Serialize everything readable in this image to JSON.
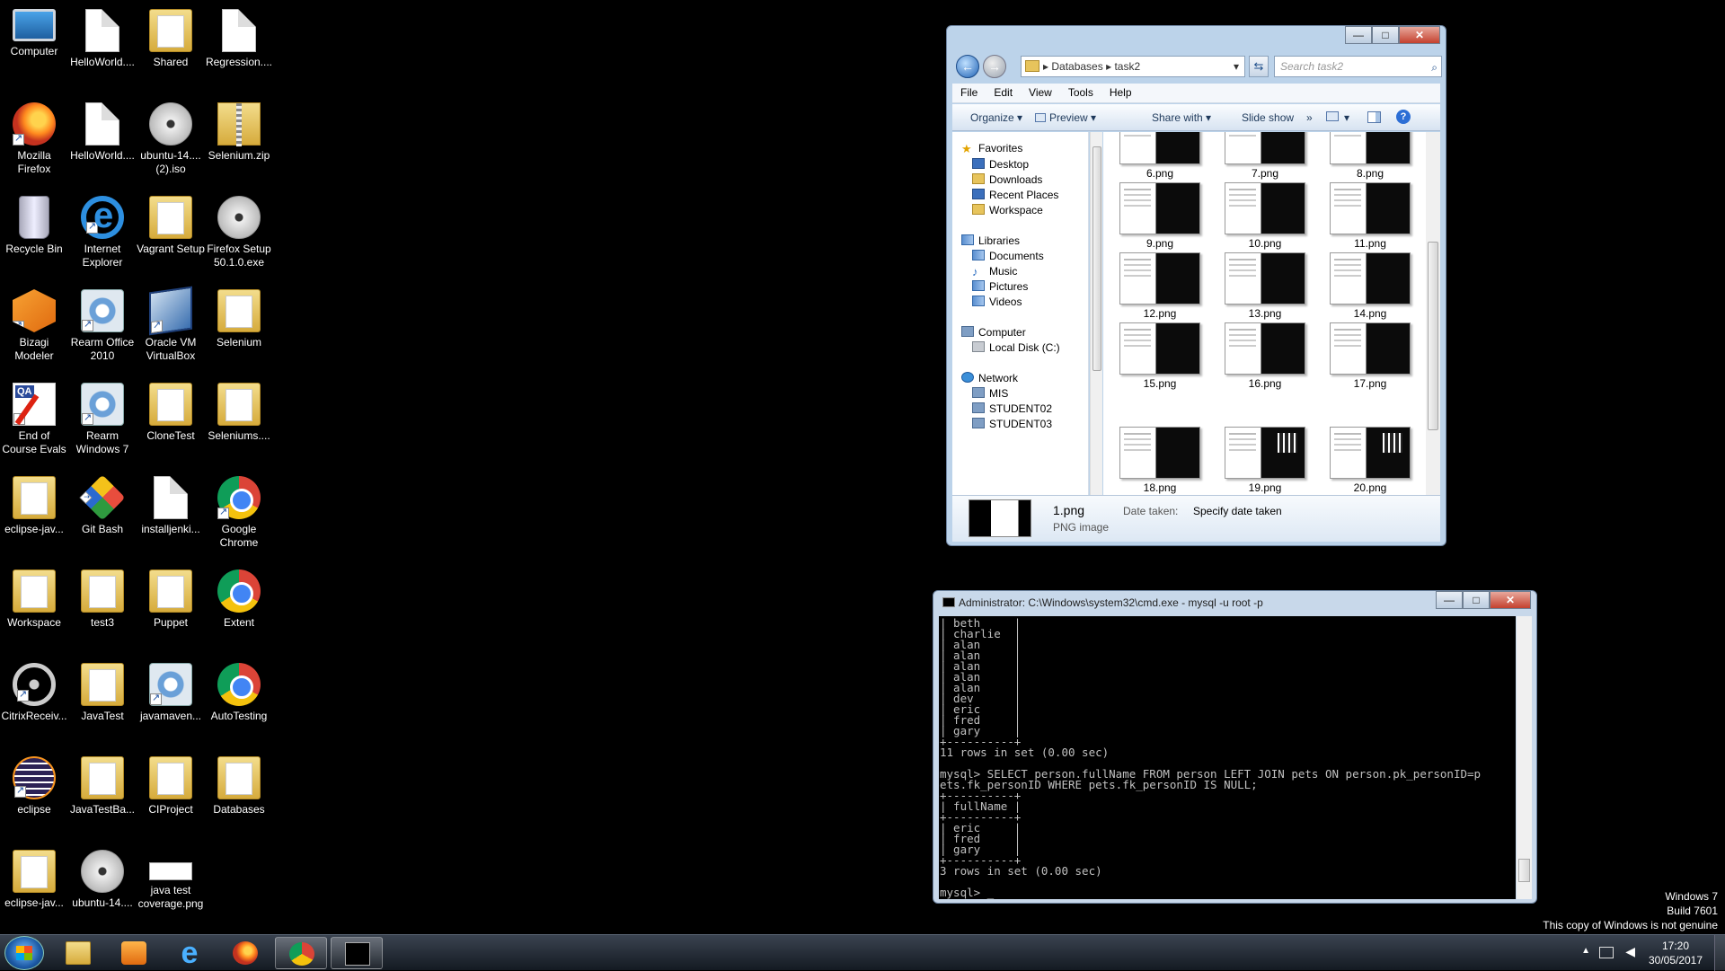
{
  "desktop": {
    "icons": [
      {
        "label": "Computer",
        "icon": "computer-icon"
      },
      {
        "label": "HelloWorld....",
        "icon": "file-icon"
      },
      {
        "label": "Shared",
        "icon": "folder-icon"
      },
      {
        "label": "Regression....",
        "icon": "file-icon"
      },
      {
        "label": "Mozilla Firefox",
        "icon": "firefox-icon"
      },
      {
        "label": "HelloWorld....",
        "icon": "file-icon"
      },
      {
        "label": "ubuntu-14.... (2).iso",
        "icon": "disc-image-icon"
      },
      {
        "label": "Selenium.zip",
        "icon": "zip-folder-icon"
      },
      {
        "label": "Recycle Bin",
        "icon": "recycle-bin-icon"
      },
      {
        "label": "Internet Explorer",
        "icon": "internet-explorer-icon"
      },
      {
        "label": "Vagrant Setup",
        "icon": "folder-icon"
      },
      {
        "label": "Firefox Setup 50.1.0.exe",
        "icon": "installer-icon"
      },
      {
        "label": "Bizagi Modeler",
        "icon": "bizagi-icon"
      },
      {
        "label": "Rearm Office 2010",
        "icon": "gear-icon"
      },
      {
        "label": "Oracle VM VirtualBox",
        "icon": "virtualbox-icon"
      },
      {
        "label": "Selenium",
        "icon": "folder-icon"
      },
      {
        "label": "End of Course Evals",
        "icon": "qa-icon"
      },
      {
        "label": "Rearm Windows 7",
        "icon": "gear-icon"
      },
      {
        "label": "CloneTest",
        "icon": "folder-icon"
      },
      {
        "label": "Seleniums....",
        "icon": "folder-icon"
      },
      {
        "label": "eclipse-jav...",
        "icon": "folder-icon"
      },
      {
        "label": "Git Bash",
        "icon": "git-bash-icon"
      },
      {
        "label": "installjenki...",
        "icon": "file-icon"
      },
      {
        "label": "Google Chrome",
        "icon": "chrome-icon"
      },
      {
        "label": "Workspace",
        "icon": "folder-icon"
      },
      {
        "label": "test3",
        "icon": "folder-icon"
      },
      {
        "label": "Puppet",
        "icon": "folder-icon"
      },
      {
        "label": "Extent",
        "icon": "chrome-html-icon"
      },
      {
        "label": "CitrixReceiv...",
        "icon": "citrix-icon"
      },
      {
        "label": "JavaTest",
        "icon": "folder-icon"
      },
      {
        "label": "javamaven...",
        "icon": "gear-icon"
      },
      {
        "label": "AutoTesting",
        "icon": "chrome-html-icon"
      },
      {
        "label": "eclipse",
        "icon": "eclipse-icon"
      },
      {
        "label": "JavaTestBa...",
        "icon": "folder-icon"
      },
      {
        "label": "CIProject",
        "icon": "folder-icon"
      },
      {
        "label": "Databases",
        "icon": "folder-icon"
      },
      {
        "label": "eclipse-jav...",
        "icon": "folder-icon"
      },
      {
        "label": "ubuntu-14....",
        "icon": "disc-image-icon"
      },
      {
        "label": "java test coverage.png",
        "icon": "image-file-icon"
      }
    ]
  },
  "explorer": {
    "breadcrumb": [
      "Databases",
      "task2"
    ],
    "search_placeholder": "Search task2",
    "menu": [
      "File",
      "Edit",
      "View",
      "Tools",
      "Help"
    ],
    "toolbar": {
      "organize": "Organize ▾",
      "preview": "Preview ▾",
      "share": "Share with ▾",
      "slideshow": "Slide show",
      "more": "»"
    },
    "nav": {
      "favorites": "Favorites",
      "desktop": "Desktop",
      "downloads": "Downloads",
      "recent": "Recent Places",
      "workspace": "Workspace",
      "libraries": "Libraries",
      "documents": "Documents",
      "music": "Music",
      "pictures": "Pictures",
      "videos": "Videos",
      "computer": "Computer",
      "localdisk": "Local Disk (C:)",
      "network": "Network",
      "mis": "MIS",
      "student02": "STUDENT02",
      "student03": "STUDENT03"
    },
    "files": [
      "6.png",
      "7.png",
      "8.png",
      "9.png",
      "10.png",
      "11.png",
      "12.png",
      "13.png",
      "14.png",
      "15.png",
      "16.png",
      "17.png",
      "18.png",
      "19.png",
      "20.png"
    ],
    "details": {
      "filename": "1.png",
      "filetype": "PNG image",
      "date_label": "Date taken:",
      "date_value": "Specify date taken"
    }
  },
  "cmd": {
    "title": "Administrator: C:\\Windows\\system32\\cmd.exe - mysql  -u root -p",
    "output": "| beth     |\n| charlie  |\n| alan     |\n| alan     |\n| alan     |\n| alan     |\n| alan     |\n| dev      |\n| eric     |\n| fred     |\n| gary     |\n+----------+\n11 rows in set (0.00 sec)\n\nmysql> SELECT person.fullName FROM person LEFT JOIN pets ON person.pk_personID=p\nets.fk_personID WHERE pets.fk_personID IS NULL;\n+----------+\n| fullName |\n+----------+\n| eric     |\n| fred     |\n| gary     |\n+----------+\n3 rows in set (0.00 sec)\n\nmysql> _"
  },
  "watermark": {
    "line1": "Windows 7",
    "line2": "Build 7601",
    "line3": "This copy of Windows is not genuine"
  },
  "taskbar": {
    "time": "17:20",
    "date": "30/05/2017"
  }
}
